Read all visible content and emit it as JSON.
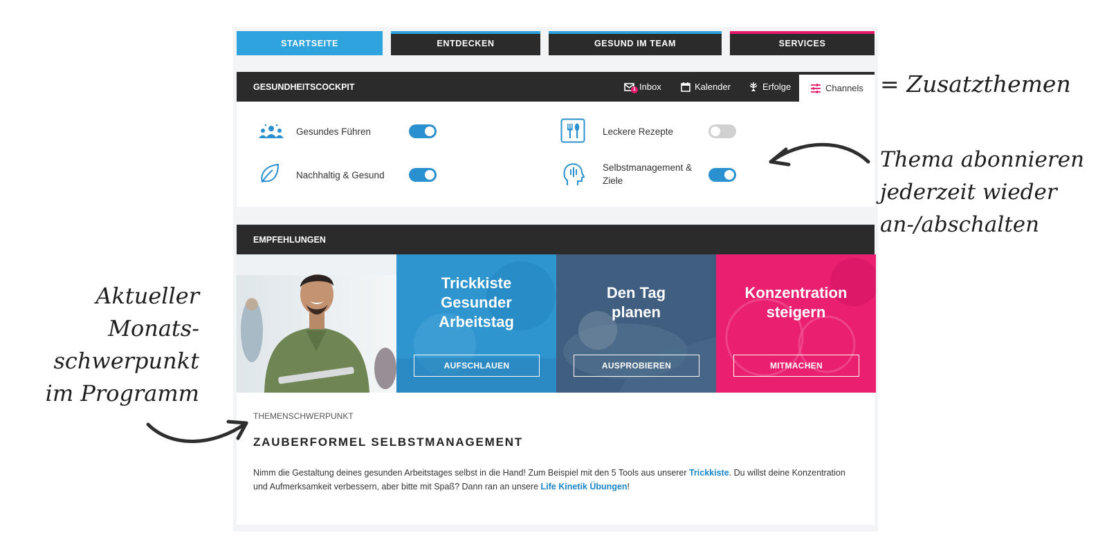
{
  "nav": {
    "tabs": [
      {
        "label": "STARTSEITE",
        "active": true,
        "bar_color": "#2ea3de"
      },
      {
        "label": "ENTDECKEN",
        "active": false,
        "bar_color": "#2ea3de"
      },
      {
        "label": "GESUND IM TEAM",
        "active": false,
        "bar_color": "#2ea3de"
      },
      {
        "label": "SERVICES",
        "active": false,
        "bar_color": "#e8196b"
      }
    ]
  },
  "cockpit": {
    "title": "GESUNDHEITSCOCKPIT",
    "tabs": [
      {
        "label": "Inbox",
        "icon": "mail-icon",
        "badge": "1"
      },
      {
        "label": "Kalender",
        "icon": "calendar-icon"
      },
      {
        "label": "Erfolge",
        "icon": "trophy-icon"
      },
      {
        "label": "Channels",
        "icon": "sliders-icon",
        "active": true
      }
    ],
    "channels": [
      {
        "label": "Gesundes Führen",
        "icon": "team-icon",
        "enabled": true
      },
      {
        "label": "Leckere Rezepte",
        "icon": "cutlery-icon",
        "enabled": false
      },
      {
        "label": "Nachhaltig & Gesund",
        "icon": "leaf-icon",
        "enabled": true
      },
      {
        "label_line1": "Selbstmanagement &",
        "label_line2": "Ziele",
        "icon": "head-icon",
        "enabled": true
      }
    ]
  },
  "recommendations": {
    "title": "EMPFEHLUNGEN",
    "tiles": [
      {
        "kind": "photo",
        "description_icon": "smiling-man-photo"
      },
      {
        "title_lines": [
          "Trickkiste",
          "Gesunder",
          "Arbeitstag"
        ],
        "button": "AUFSCHLAUEN",
        "color": "#2b8fc9"
      },
      {
        "title_lines": [
          "Den Tag",
          "planen"
        ],
        "button": "AUSPROBIEREN",
        "color": "#3d5a7a"
      },
      {
        "title_lines": [
          "Konzentration",
          "steigern"
        ],
        "button": "MITMACHEN",
        "color": "#e8196b"
      }
    ]
  },
  "focus": {
    "kicker": "THEMENSCHWERPUNKT",
    "title": "ZAUBERFORMEL SELBSTMANAGEMENT",
    "text_part1": "Nimm die Gestaltung deines gesunden Arbeitstages selbst in die Hand! Zum Beispiel mit den 5 Tools aus unserer ",
    "link1": "Trickkiste",
    "text_part2": ". Du willst deine Konzentration und Aufmerksamkeit verbessern, aber bitte mit Spaß? Dann ran an unsere ",
    "link2": "Life Kinetik Übungen",
    "text_part3": "!"
  },
  "annotations": {
    "zusatz": "= Zusatzthemen",
    "abo_lines": [
      "Thema abonnieren",
      "jederzeit wieder",
      "an-/abschalten"
    ],
    "left_lines": [
      "Aktueller",
      "Monats-",
      "schwerpunkt",
      "im Programm"
    ]
  },
  "colors": {
    "accent_blue": "#2ea3de",
    "accent_pink": "#e8196b",
    "dark": "#2b2b2b",
    "toggle_on": "#2a90cf"
  }
}
